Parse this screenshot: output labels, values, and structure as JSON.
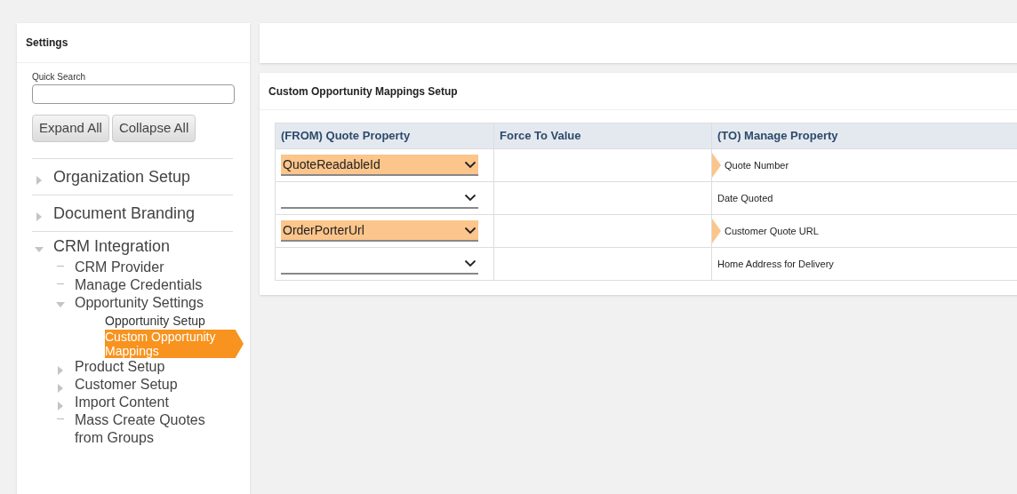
{
  "sidebar": {
    "title": "Settings",
    "search": {
      "label": "Quick Search"
    },
    "buttons": [
      "Expand All",
      "Collapse All"
    ],
    "tree": [
      {
        "label": "Organization Setup",
        "kind": "folder",
        "expanded": false
      },
      {
        "label": "Document Branding",
        "kind": "folder",
        "expanded": false
      },
      {
        "label": "CRM Integration",
        "kind": "folder",
        "expanded": true,
        "children": [
          {
            "label": "CRM Provider",
            "kind": "leaf"
          },
          {
            "label": "Manage Credentials",
            "kind": "leaf"
          },
          {
            "label": "Opportunity Settings",
            "kind": "folder",
            "expanded": true,
            "children": [
              {
                "label": "Opportunity Setup",
                "kind": "page",
                "selected": false
              },
              {
                "label": "Custom Opportunity Mappings",
                "kind": "page",
                "selected": true
              }
            ]
          },
          {
            "label": "Product Setup",
            "kind": "folder",
            "expanded": false
          },
          {
            "label": "Customer Setup",
            "kind": "folder",
            "expanded": false
          },
          {
            "label": "Import Content",
            "kind": "folder",
            "expanded": false
          },
          {
            "label": "Mass Create Quotes from Groups",
            "kind": "leaf"
          }
        ]
      }
    ]
  },
  "panel": {
    "title": "Custom Opportunity Mappings Setup",
    "columns": [
      "(FROM) Quote Property",
      "Force To Value",
      "(TO) Manage Property"
    ],
    "rows": [
      {
        "from": "QuoteReadableId",
        "mapped": true,
        "to": "Quote Number"
      },
      {
        "from": "",
        "mapped": false,
        "to": "Date Quoted"
      },
      {
        "from": "OrderPorterUrl",
        "mapped": true,
        "to": "Customer Quote URL"
      },
      {
        "from": "",
        "mapped": false,
        "to": "Home Address for Delivery"
      }
    ]
  }
}
